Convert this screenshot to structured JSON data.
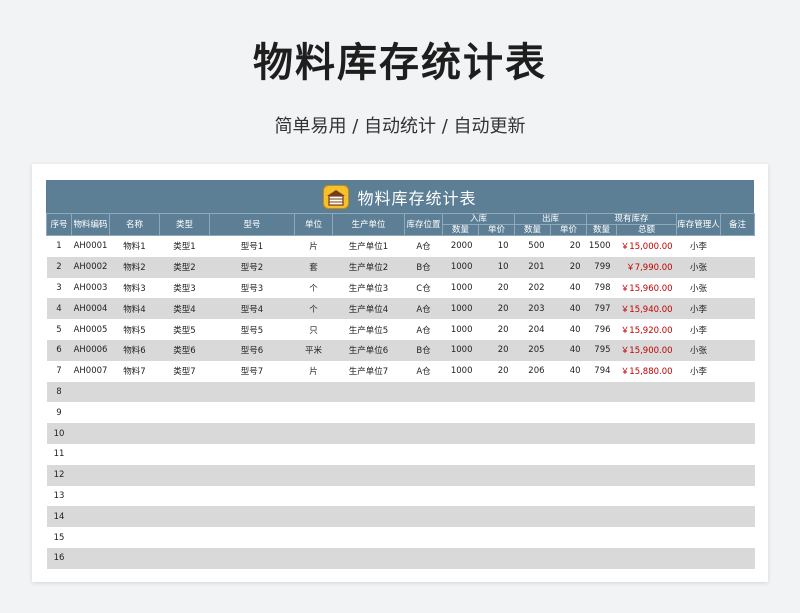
{
  "hero": {
    "title": "物料库存统计表",
    "subtitle": "简单易用 / 自动统计 / 自动更新"
  },
  "sheet": {
    "title": "物料库存统计表",
    "icon": "warehouse-icon",
    "header_color": "#5d7f96",
    "money_color": "#c00000",
    "headers": {
      "seq": "序号",
      "code": "物料编码",
      "name": "名称",
      "type": "类型",
      "model": "型号",
      "unit": "单位",
      "maker": "生产单位",
      "location": "库存位置",
      "inbound": "入库",
      "outbound": "出库",
      "current": "现有库存",
      "manager": "库存管理人",
      "remark": "备注",
      "qty": "数量",
      "price": "单价",
      "total": "总额"
    },
    "rows": [
      {
        "seq": "1",
        "code": "AH0001",
        "name": "物料1",
        "type": "类型1",
        "model": "型号1",
        "unit": "片",
        "maker": "生产单位1",
        "location": "A仓",
        "in_qty": "2000",
        "in_price": "10",
        "out_qty": "500",
        "out_price": "20",
        "cur_qty": "1500",
        "cur_total": "￥15,000.00",
        "manager": "小李",
        "remark": ""
      },
      {
        "seq": "2",
        "code": "AH0002",
        "name": "物料2",
        "type": "类型2",
        "model": "型号2",
        "unit": "套",
        "maker": "生产单位2",
        "location": "B仓",
        "in_qty": "1000",
        "in_price": "10",
        "out_qty": "201",
        "out_price": "20",
        "cur_qty": "799",
        "cur_total": "￥7,990.00",
        "manager": "小张",
        "remark": ""
      },
      {
        "seq": "3",
        "code": "AH0003",
        "name": "物料3",
        "type": "类型3",
        "model": "型号3",
        "unit": "个",
        "maker": "生产单位3",
        "location": "C仓",
        "in_qty": "1000",
        "in_price": "20",
        "out_qty": "202",
        "out_price": "40",
        "cur_qty": "798",
        "cur_total": "￥15,960.00",
        "manager": "小张",
        "remark": ""
      },
      {
        "seq": "4",
        "code": "AH0004",
        "name": "物料4",
        "type": "类型4",
        "model": "型号4",
        "unit": "个",
        "maker": "生产单位4",
        "location": "A仓",
        "in_qty": "1000",
        "in_price": "20",
        "out_qty": "203",
        "out_price": "40",
        "cur_qty": "797",
        "cur_total": "￥15,940.00",
        "manager": "小李",
        "remark": ""
      },
      {
        "seq": "5",
        "code": "AH0005",
        "name": "物料5",
        "type": "类型5",
        "model": "型号5",
        "unit": "只",
        "maker": "生产单位5",
        "location": "A仓",
        "in_qty": "1000",
        "in_price": "20",
        "out_qty": "204",
        "out_price": "40",
        "cur_qty": "796",
        "cur_total": "￥15,920.00",
        "manager": "小李",
        "remark": ""
      },
      {
        "seq": "6",
        "code": "AH0006",
        "name": "物料6",
        "type": "类型6",
        "model": "型号6",
        "unit": "平米",
        "maker": "生产单位6",
        "location": "B仓",
        "in_qty": "1000",
        "in_price": "20",
        "out_qty": "205",
        "out_price": "40",
        "cur_qty": "795",
        "cur_total": "￥15,900.00",
        "manager": "小张",
        "remark": ""
      },
      {
        "seq": "7",
        "code": "AH0007",
        "name": "物料7",
        "type": "类型7",
        "model": "型号7",
        "unit": "片",
        "maker": "生产单位7",
        "location": "A仓",
        "in_qty": "1000",
        "in_price": "20",
        "out_qty": "206",
        "out_price": "40",
        "cur_qty": "794",
        "cur_total": "￥15,880.00",
        "manager": "小李",
        "remark": ""
      },
      {
        "seq": "8"
      },
      {
        "seq": "9"
      },
      {
        "seq": "10"
      },
      {
        "seq": "11"
      },
      {
        "seq": "12"
      },
      {
        "seq": "13"
      },
      {
        "seq": "14"
      },
      {
        "seq": "15"
      },
      {
        "seq": "16"
      }
    ]
  }
}
